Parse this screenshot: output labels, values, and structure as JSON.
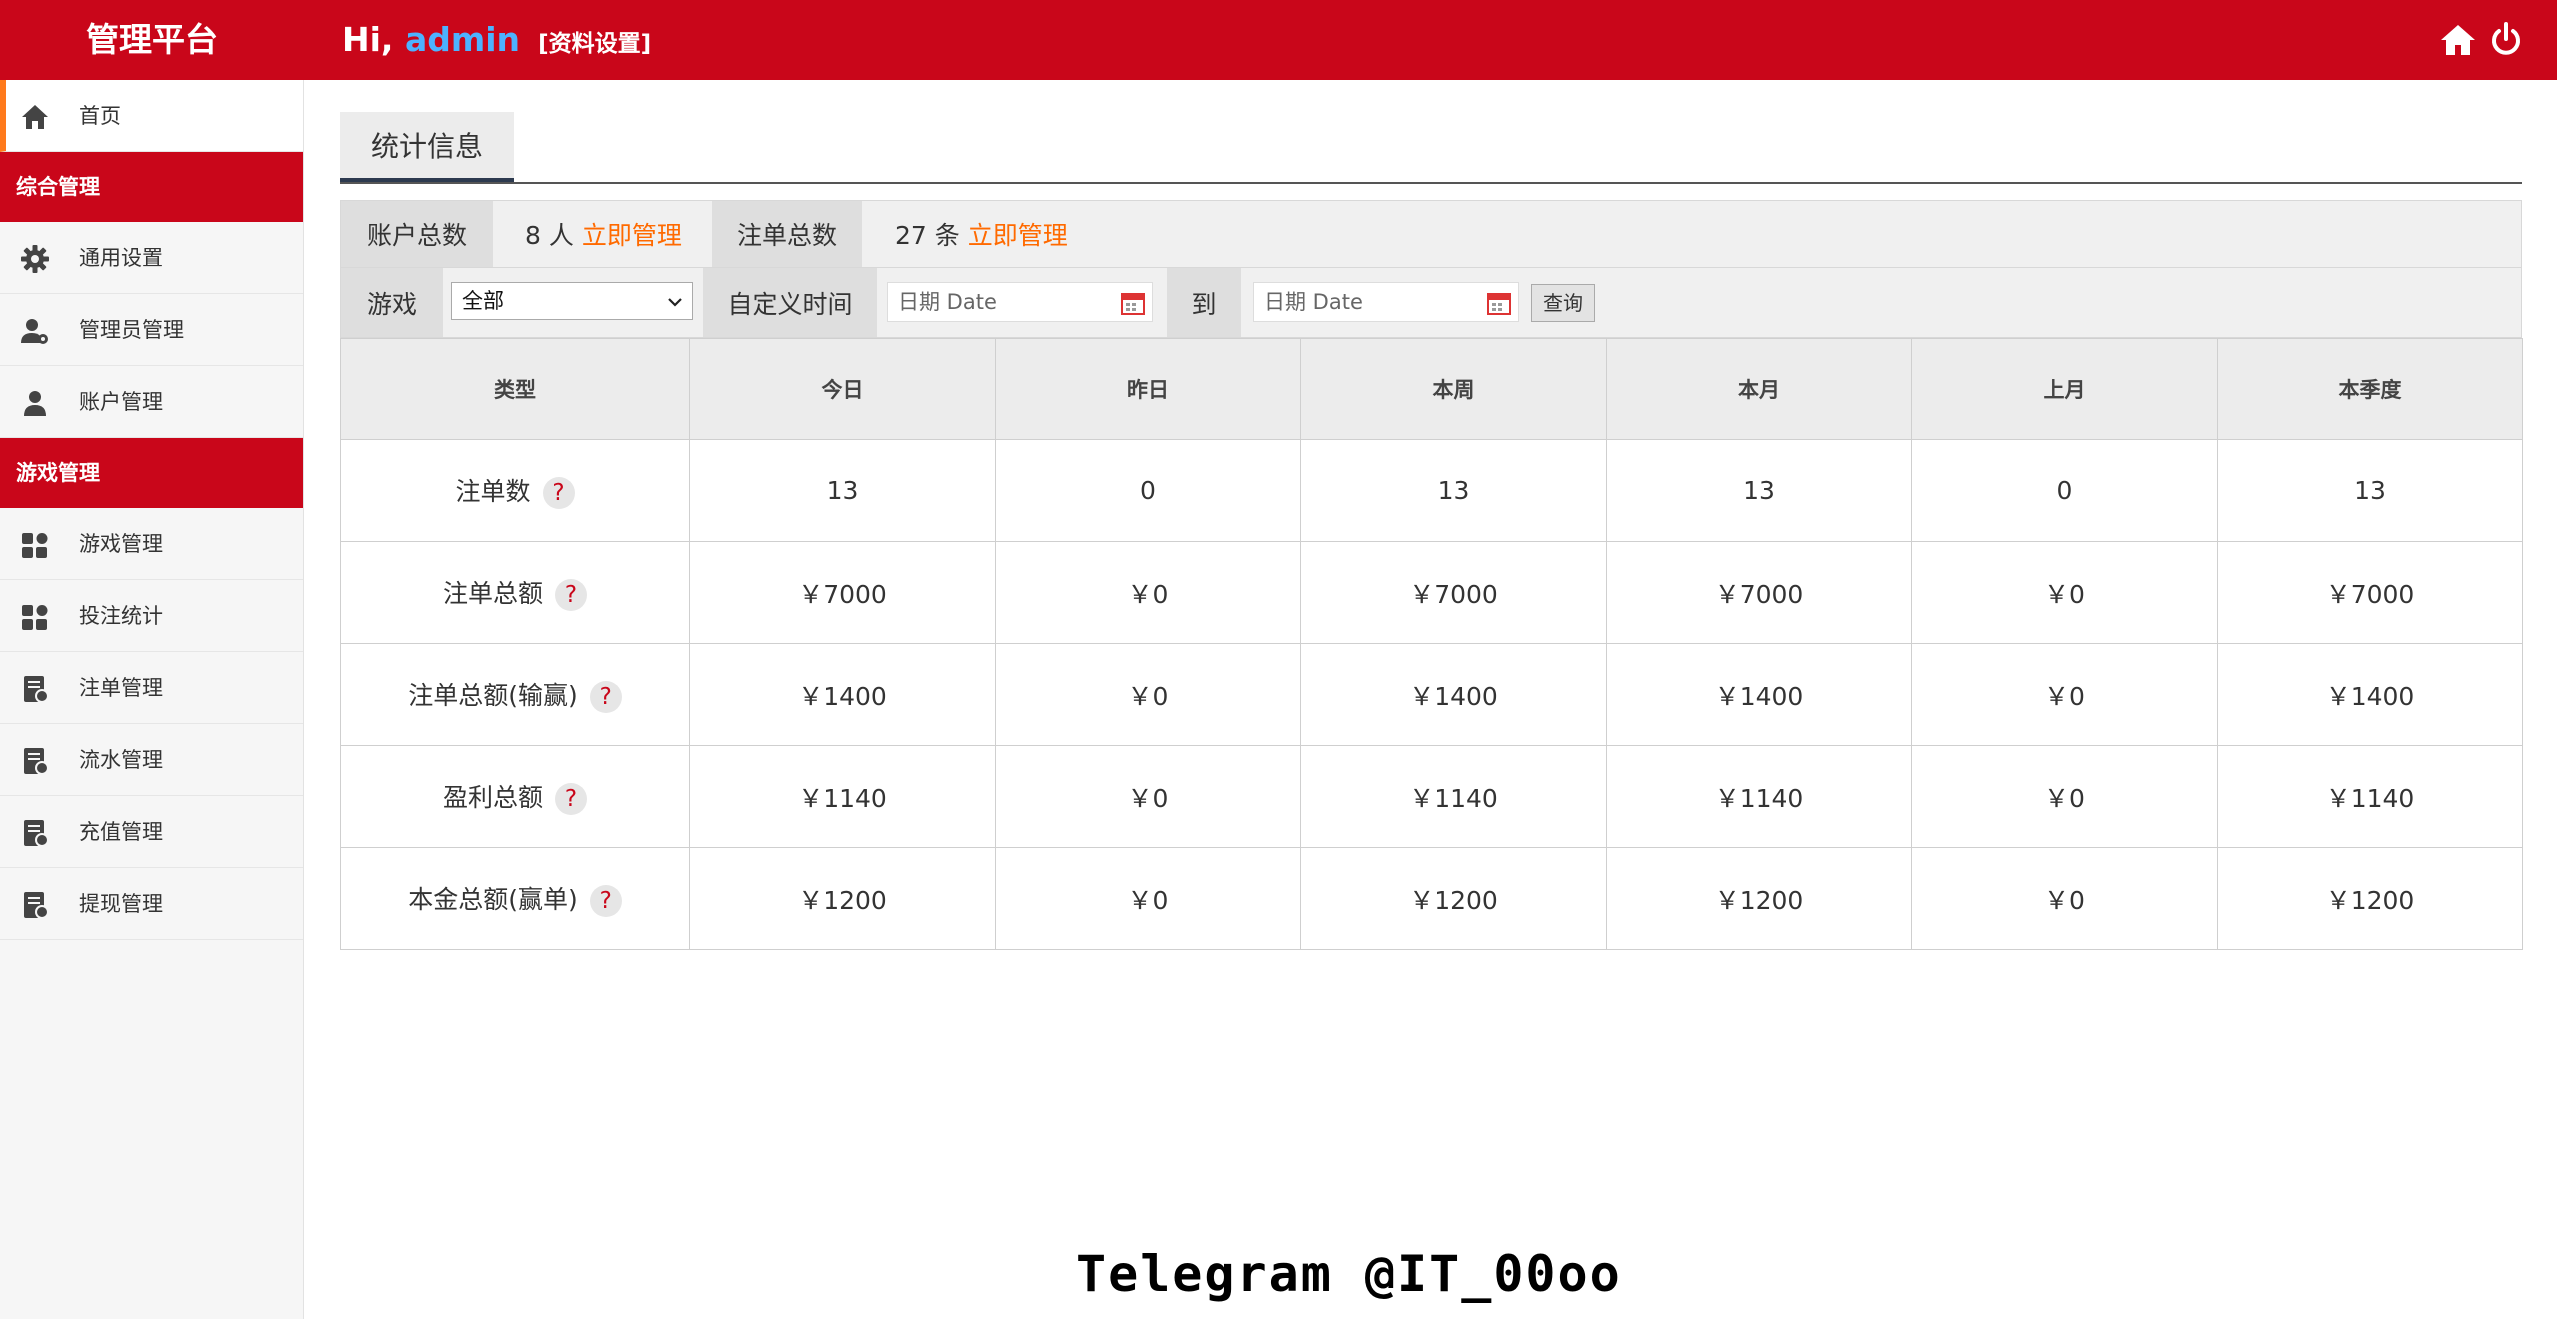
{
  "header": {
    "brand": "管理平台",
    "greeting_prefix": "Hi, ",
    "username": "admin",
    "profile_link": "[资料设置]",
    "icons": [
      "home-icon",
      "power-icon"
    ]
  },
  "sidebar": {
    "home": {
      "label": "首页",
      "icon": "home-icon"
    },
    "sections": [
      {
        "title": "综合管理",
        "items": [
          {
            "label": "通用设置",
            "icon": "gear-icon"
          },
          {
            "label": "管理员管理",
            "icon": "admin-user-icon"
          },
          {
            "label": "账户管理",
            "icon": "user-icon"
          }
        ]
      },
      {
        "title": "游戏管理",
        "items": [
          {
            "label": "游戏管理",
            "icon": "grid-icon"
          },
          {
            "label": "投注统计",
            "icon": "grid-icon"
          },
          {
            "label": "注单管理",
            "icon": "document-icon"
          },
          {
            "label": "流水管理",
            "icon": "document-icon"
          },
          {
            "label": "充值管理",
            "icon": "document-icon"
          },
          {
            "label": "提现管理",
            "icon": "document-icon"
          }
        ]
      }
    ]
  },
  "main": {
    "tab": "统计信息",
    "summary": {
      "accounts_label": "账户总数",
      "accounts_value": "8 人",
      "accounts_link": "立即管理",
      "orders_label": "注单总数",
      "orders_value": "27 条",
      "orders_link": "立即管理"
    },
    "filter": {
      "game_label": "游戏",
      "game_selected": "全部",
      "time_label": "自定义时间",
      "date_placeholder": "日期 Date",
      "to_label": "到",
      "query_button": "查询"
    },
    "table": {
      "headers": [
        "类型",
        "今日",
        "昨日",
        "本周",
        "本月",
        "上月",
        "本季度"
      ],
      "help_glyph": "?",
      "rows": [
        {
          "type": "注单数",
          "values": [
            "13",
            "0",
            "13",
            "13",
            "0",
            "13"
          ]
        },
        {
          "type": "注单总额",
          "values": [
            "￥7000",
            "￥0",
            "￥7000",
            "￥7000",
            "￥0",
            "￥7000"
          ]
        },
        {
          "type": "注单总额(输赢)",
          "values": [
            "￥1400",
            "￥0",
            "￥1400",
            "￥1400",
            "￥0",
            "￥1400"
          ]
        },
        {
          "type": "盈利总额",
          "values": [
            "￥1140",
            "￥0",
            "￥1140",
            "￥1140",
            "￥0",
            "￥1140"
          ]
        },
        {
          "type": "本金总额(赢单)",
          "values": [
            "￥1200",
            "￥0",
            "￥1200",
            "￥1200",
            "￥0",
            "￥1200"
          ]
        }
      ]
    }
  },
  "watermark": "Telegram @IT_00oo",
  "colors": {
    "brand_red": "#c9061a",
    "accent_orange": "#ff6a00",
    "username_blue": "#4db2ff"
  }
}
